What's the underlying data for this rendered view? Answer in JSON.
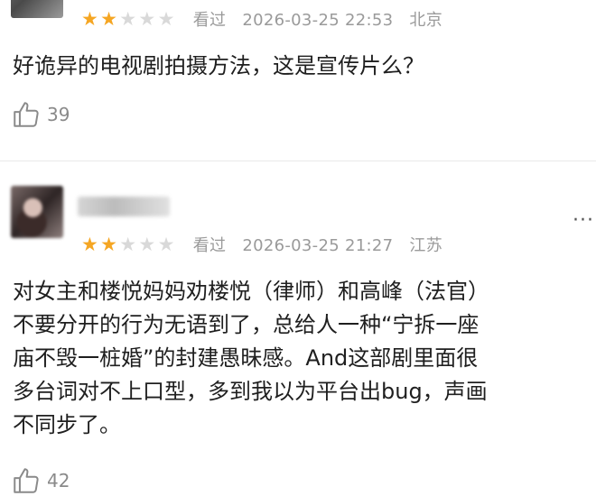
{
  "comments": [
    {
      "stars_filled": 2,
      "stars_total": 5,
      "status": "看过",
      "datetime": "2026-03-25 22:53",
      "location": "北京",
      "text_lines": [
        "好诡异的电视剧拍摄方法，这是宣传片么？"
      ],
      "likes": "39"
    },
    {
      "stars_filled": 2,
      "stars_total": 5,
      "status": "看过",
      "datetime": "2026-03-25 21:27",
      "location": "江苏",
      "text_lines": [
        "对女主和楼悦妈妈劝楼悦（律师）和高峰（法官）",
        "不要分开的行为无语到了，总给人一种“宁拆一座",
        "庙不毁一桩婚”的封建愚昧感。And这部剧里面很",
        "多台词对不上口型，多到我以为平台出bug，声画",
        "不同步了。"
      ],
      "likes": "42"
    }
  ],
  "more_icon": "more-dots-icon",
  "like_icon": "thumbs-up-icon",
  "star_icon": "star-icon",
  "colors": {
    "star_on": "#f5a623",
    "star_off": "#d9d9d9",
    "meta": "#9a9a9a"
  }
}
